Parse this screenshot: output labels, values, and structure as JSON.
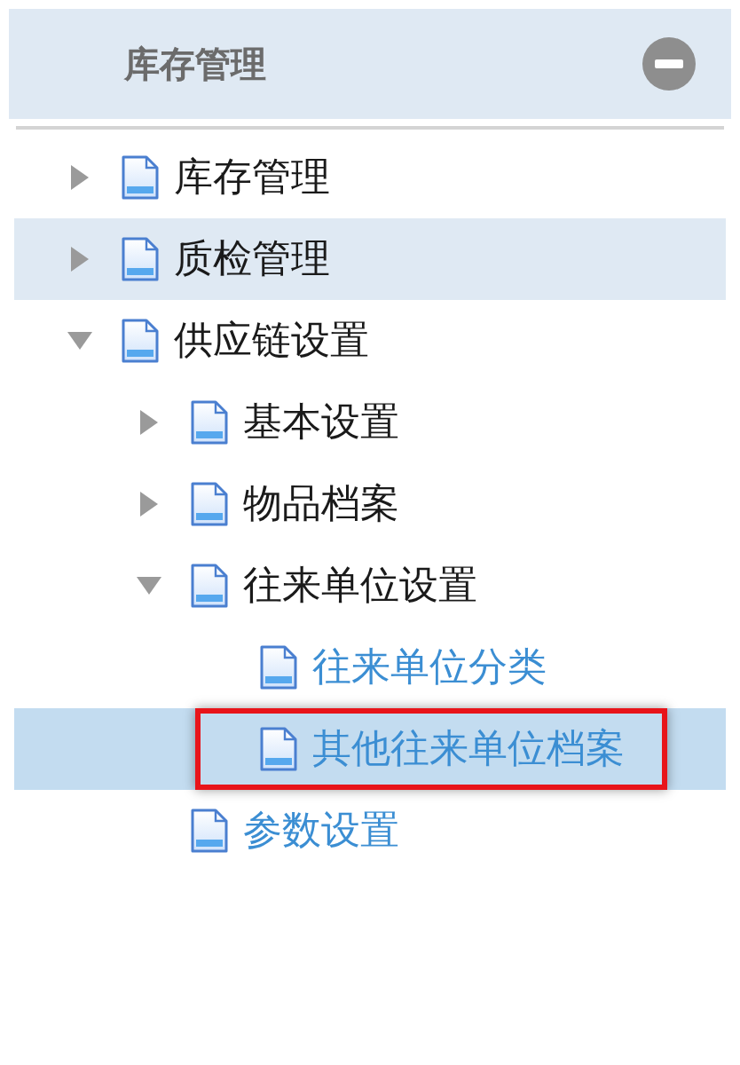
{
  "panel": {
    "title": "库存管理"
  },
  "tree": [
    {
      "label": "库存管理",
      "kind": "folder",
      "expanded": false,
      "hovered": false,
      "selected": false,
      "marked": false
    },
    {
      "label": "质检管理",
      "kind": "folder",
      "expanded": false,
      "hovered": true,
      "selected": false,
      "marked": false
    },
    {
      "label": "供应链设置",
      "kind": "folder",
      "expanded": true,
      "hovered": false,
      "selected": false,
      "marked": false,
      "children": [
        {
          "label": "基本设置",
          "kind": "folder",
          "expanded": false,
          "hovered": false,
          "selected": false,
          "marked": false
        },
        {
          "label": "物品档案",
          "kind": "folder",
          "expanded": false,
          "hovered": false,
          "selected": false,
          "marked": false
        },
        {
          "label": "往来单位设置",
          "kind": "folder",
          "expanded": true,
          "hovered": false,
          "selected": false,
          "marked": false,
          "children": [
            {
              "label": "往来单位分类",
              "kind": "leaf",
              "hovered": false,
              "selected": false,
              "marked": false
            },
            {
              "label": "其他往来单位档案",
              "kind": "leaf",
              "hovered": false,
              "selected": true,
              "marked": true
            }
          ]
        },
        {
          "label": "参数设置",
          "kind": "leaf",
          "hovered": false,
          "selected": false,
          "marked": false
        }
      ]
    }
  ]
}
